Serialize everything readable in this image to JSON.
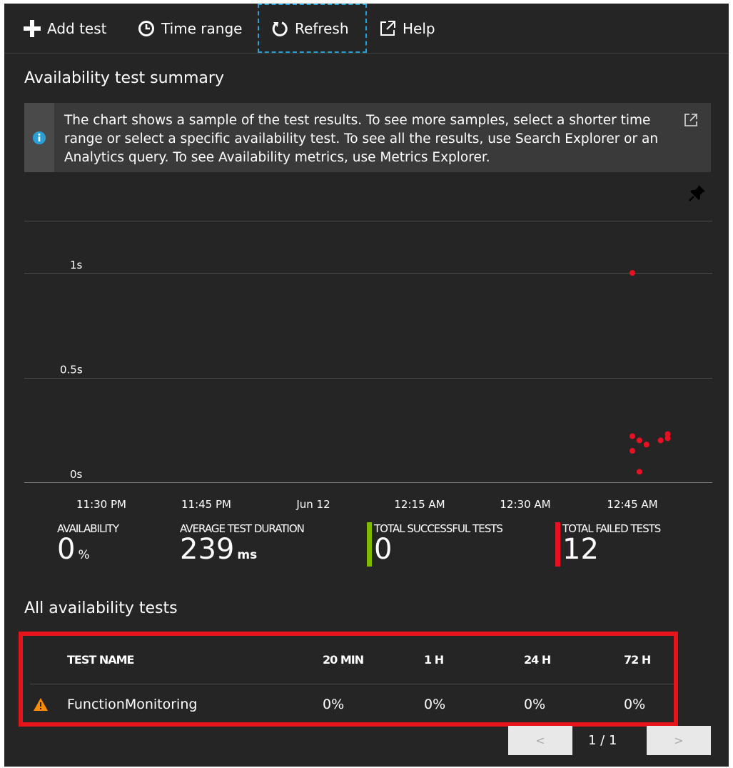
{
  "toolbar": {
    "add_test": "Add test",
    "time_range": "Time range",
    "refresh": "Refresh",
    "help": "Help"
  },
  "summary": {
    "title": "Availability test summary",
    "info_text": "The chart shows a sample of the test results. To see more samples, select a shorter time range or select a specific availability test. To see all the results, use Search Explorer or an Analytics query. To see Availability metrics, use Metrics Explorer."
  },
  "chart_data": {
    "type": "scatter",
    "title": "",
    "xlabel": "",
    "ylabel": "",
    "y_ticks": [
      "1s",
      "0.5s",
      "0s"
    ],
    "x_ticks": [
      "11:30 PM",
      "11:45 PM",
      "Jun 12",
      "12:15 AM",
      "12:30 AM",
      "12:45 AM"
    ],
    "ylim": [
      0,
      1.25
    ],
    "grid": true,
    "series": [
      {
        "color": "#e81123",
        "points": [
          {
            "x": "12:45 AM",
            "y": 1.0
          },
          {
            "x": "12:45 AM",
            "y": 0.22
          },
          {
            "x": "12:46 AM",
            "y": 0.2
          },
          {
            "x": "12:47 AM",
            "y": 0.18
          },
          {
            "x": "12:45 AM",
            "y": 0.15
          },
          {
            "x": "12:49 AM",
            "y": 0.2
          },
          {
            "x": "12:50 AM",
            "y": 0.21
          },
          {
            "x": "12:50 AM",
            "y": 0.23
          },
          {
            "x": "12:46 AM",
            "y": 0.05
          }
        ]
      }
    ]
  },
  "metrics": {
    "availability_label": "AVAILABILITY",
    "availability_value": "0",
    "availability_unit": "%",
    "avg_duration_label": "AVERAGE TEST DURATION",
    "avg_duration_value": "239",
    "avg_duration_unit": "ms",
    "successful_label": "TOTAL SUCCESSFUL TESTS",
    "successful_value": "0",
    "failed_label": "TOTAL FAILED TESTS",
    "failed_value": "12",
    "success_color": "#7fba00",
    "fail_color": "#e81123"
  },
  "tests": {
    "title": "All availability tests",
    "columns": [
      "TEST NAME",
      "20 MIN",
      "1 H",
      "24 H",
      "72 H"
    ],
    "rows": [
      {
        "name": "FunctionMonitoring",
        "status_icon": "warning-icon",
        "values": [
          "0%",
          "0%",
          "0%",
          "0%"
        ]
      }
    ],
    "pager": {
      "prev": "<",
      "label": "1 / 1",
      "next": ">"
    }
  }
}
